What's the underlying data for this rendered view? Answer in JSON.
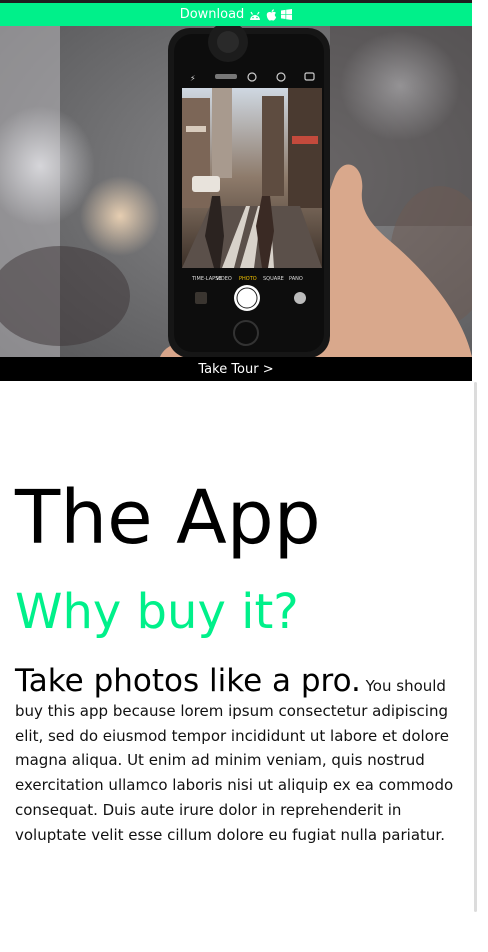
{
  "download_bar": {
    "label": "Download",
    "icons": [
      "android-icon",
      "apple-icon",
      "windows-icon"
    ],
    "background": "#00f08a"
  },
  "hero": {
    "camera_modes": [
      "TIME-LAPSE",
      "VIDEO",
      "PHOTO",
      "SQUARE",
      "PANO"
    ]
  },
  "tour_bar": {
    "label": "Take Tour >"
  },
  "main": {
    "title": "The App",
    "subtitle": "Why buy it?",
    "lead": "Take photos like a pro.",
    "body": "You should buy this app because lorem ipsum consectetur adipiscing elit, sed do eiusmod tempor incididunt ut labore et dolore magna aliqua. Ut enim ad minim veniam, quis nostrud exercitation ullamco laboris nisi ut aliquip ex ea commodo consequat. Duis aute irure dolor in reprehenderit in voluptate velit esse cillum dolore eu fugiat nulla pariatur."
  },
  "colors": {
    "accent": "#00f08a",
    "tour_bg": "#000000"
  }
}
